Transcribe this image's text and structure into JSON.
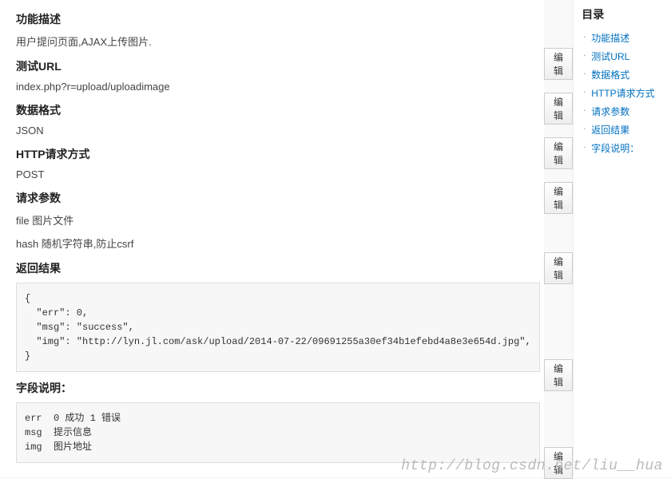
{
  "editLabel": "编辑",
  "sections": {
    "desc": {
      "title": "功能描述",
      "body": "用户提问页面,AJAX上传图片."
    },
    "url": {
      "title": "测试URL",
      "body": "index.php?r=upload/uploadimage"
    },
    "format": {
      "title": "数据格式",
      "body": "JSON"
    },
    "method": {
      "title": "HTTP请求方式",
      "body": "POST"
    },
    "params": {
      "title": "请求参数",
      "line1": "file 图片文件",
      "line2": "hash 随机字符串,防止csrf"
    },
    "result": {
      "title": "返回结果",
      "code": "{\n  \"err\": 0,\n  \"msg\": \"success\",\n  \"img\": \"http://lyn.jl.com/ask/upload/2014-07-22/09691255a30ef34b1efebd4a8e3e654d.jpg\",\n}"
    },
    "fields": {
      "title": "字段说明：",
      "code": "err  0 成功 1 错误\nmsg  提示信息\nimg  图片地址"
    }
  },
  "toc": {
    "title": "目录",
    "items": [
      "功能描述",
      "测试URL",
      "数据格式",
      "HTTP请求方式",
      "请求参数",
      "返回结果",
      "字段说明："
    ]
  },
  "watermark": "http://blog.csdn.net/liu__hua"
}
